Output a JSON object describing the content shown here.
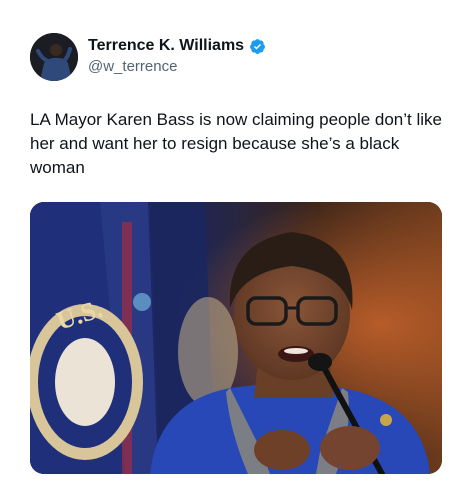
{
  "author": {
    "display_name": "Terrence K. Williams",
    "handle": "@w_terrence",
    "verified": true,
    "verified_color": "#1d9bf0"
  },
  "tweet": {
    "text": "LA Mayor Karen Bass is now claiming people don’t like her and want her to resign because she’s a black woman"
  },
  "media": {
    "kind": "photo",
    "seal_lettering": "U.S."
  }
}
